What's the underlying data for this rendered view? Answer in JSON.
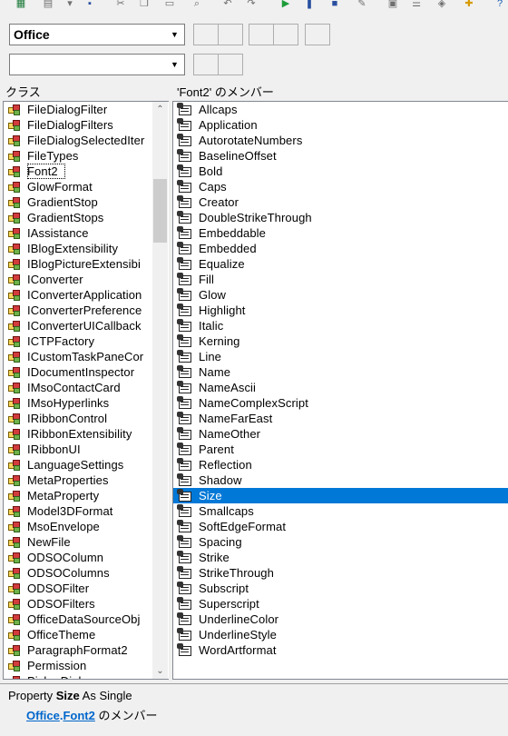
{
  "toolbar": {
    "icons": [
      "excel-icon",
      "insert-icon",
      "dropdown-icon",
      "save-icon",
      "cut-icon",
      "copy-icon",
      "paste-icon",
      "find-icon",
      "undo-icon",
      "redo-icon",
      "run-icon",
      "break-icon",
      "reset-icon",
      "design-mode-icon",
      "project-explorer-icon",
      "properties-icon",
      "object-browser-icon",
      "toolbox-icon",
      "help-icon"
    ]
  },
  "library_combo": {
    "value": "Office"
  },
  "search_combo": {
    "value": ""
  },
  "classes_pane": {
    "header": "クラス",
    "items": [
      "FileDialogFilter",
      "FileDialogFilters",
      "FileDialogSelectedIter",
      "FileTypes",
      "Font2",
      "GlowFormat",
      "GradientStop",
      "GradientStops",
      "IAssistance",
      "IBlogExtensibility",
      "IBlogPictureExtensibi",
      "IConverter",
      "IConverterApplication",
      "IConverterPreference",
      "IConverterUICallback",
      "ICTPFactory",
      "ICustomTaskPaneCor",
      "IDocumentInspector",
      "IMsoContactCard",
      "IMsoHyperlinks",
      "IRibbonControl",
      "IRibbonExtensibility",
      "IRibbonUI",
      "LanguageSettings",
      "MetaProperties",
      "MetaProperty",
      "Model3DFormat",
      "MsoEnvelope",
      "NewFile",
      "ODSOColumn",
      "ODSOColumns",
      "ODSOFilter",
      "ODSOFilters",
      "OfficeDataSourceObj",
      "OfficeTheme",
      "ParagraphFormat2",
      "Permission",
      "PickerDialog"
    ],
    "focused": "Font2"
  },
  "members_pane": {
    "header": "'Font2' のメンバー",
    "items": [
      "Allcaps",
      "Application",
      "AutorotateNumbers",
      "BaselineOffset",
      "Bold",
      "Caps",
      "Creator",
      "DoubleStrikeThrough",
      "Embeddable",
      "Embedded",
      "Equalize",
      "Fill",
      "Glow",
      "Highlight",
      "Italic",
      "Kerning",
      "Line",
      "Name",
      "NameAscii",
      "NameComplexScript",
      "NameFarEast",
      "NameOther",
      "Parent",
      "Reflection",
      "Shadow",
      "Size",
      "Smallcaps",
      "SoftEdgeFormat",
      "Spacing",
      "Strike",
      "StrikeThrough",
      "Subscript",
      "Superscript",
      "UnderlineColor",
      "UnderlineStyle",
      "WordArtformat"
    ],
    "selected": "Size"
  },
  "details": {
    "prefix": "Property ",
    "member_name": "Size",
    "type_text": " As Single",
    "library_link": "Office",
    "dot": ".",
    "class_link": "Font2",
    "suffix": " のメンバー"
  },
  "colors": {
    "selection": "#0078d7",
    "link": "#0066cc"
  }
}
